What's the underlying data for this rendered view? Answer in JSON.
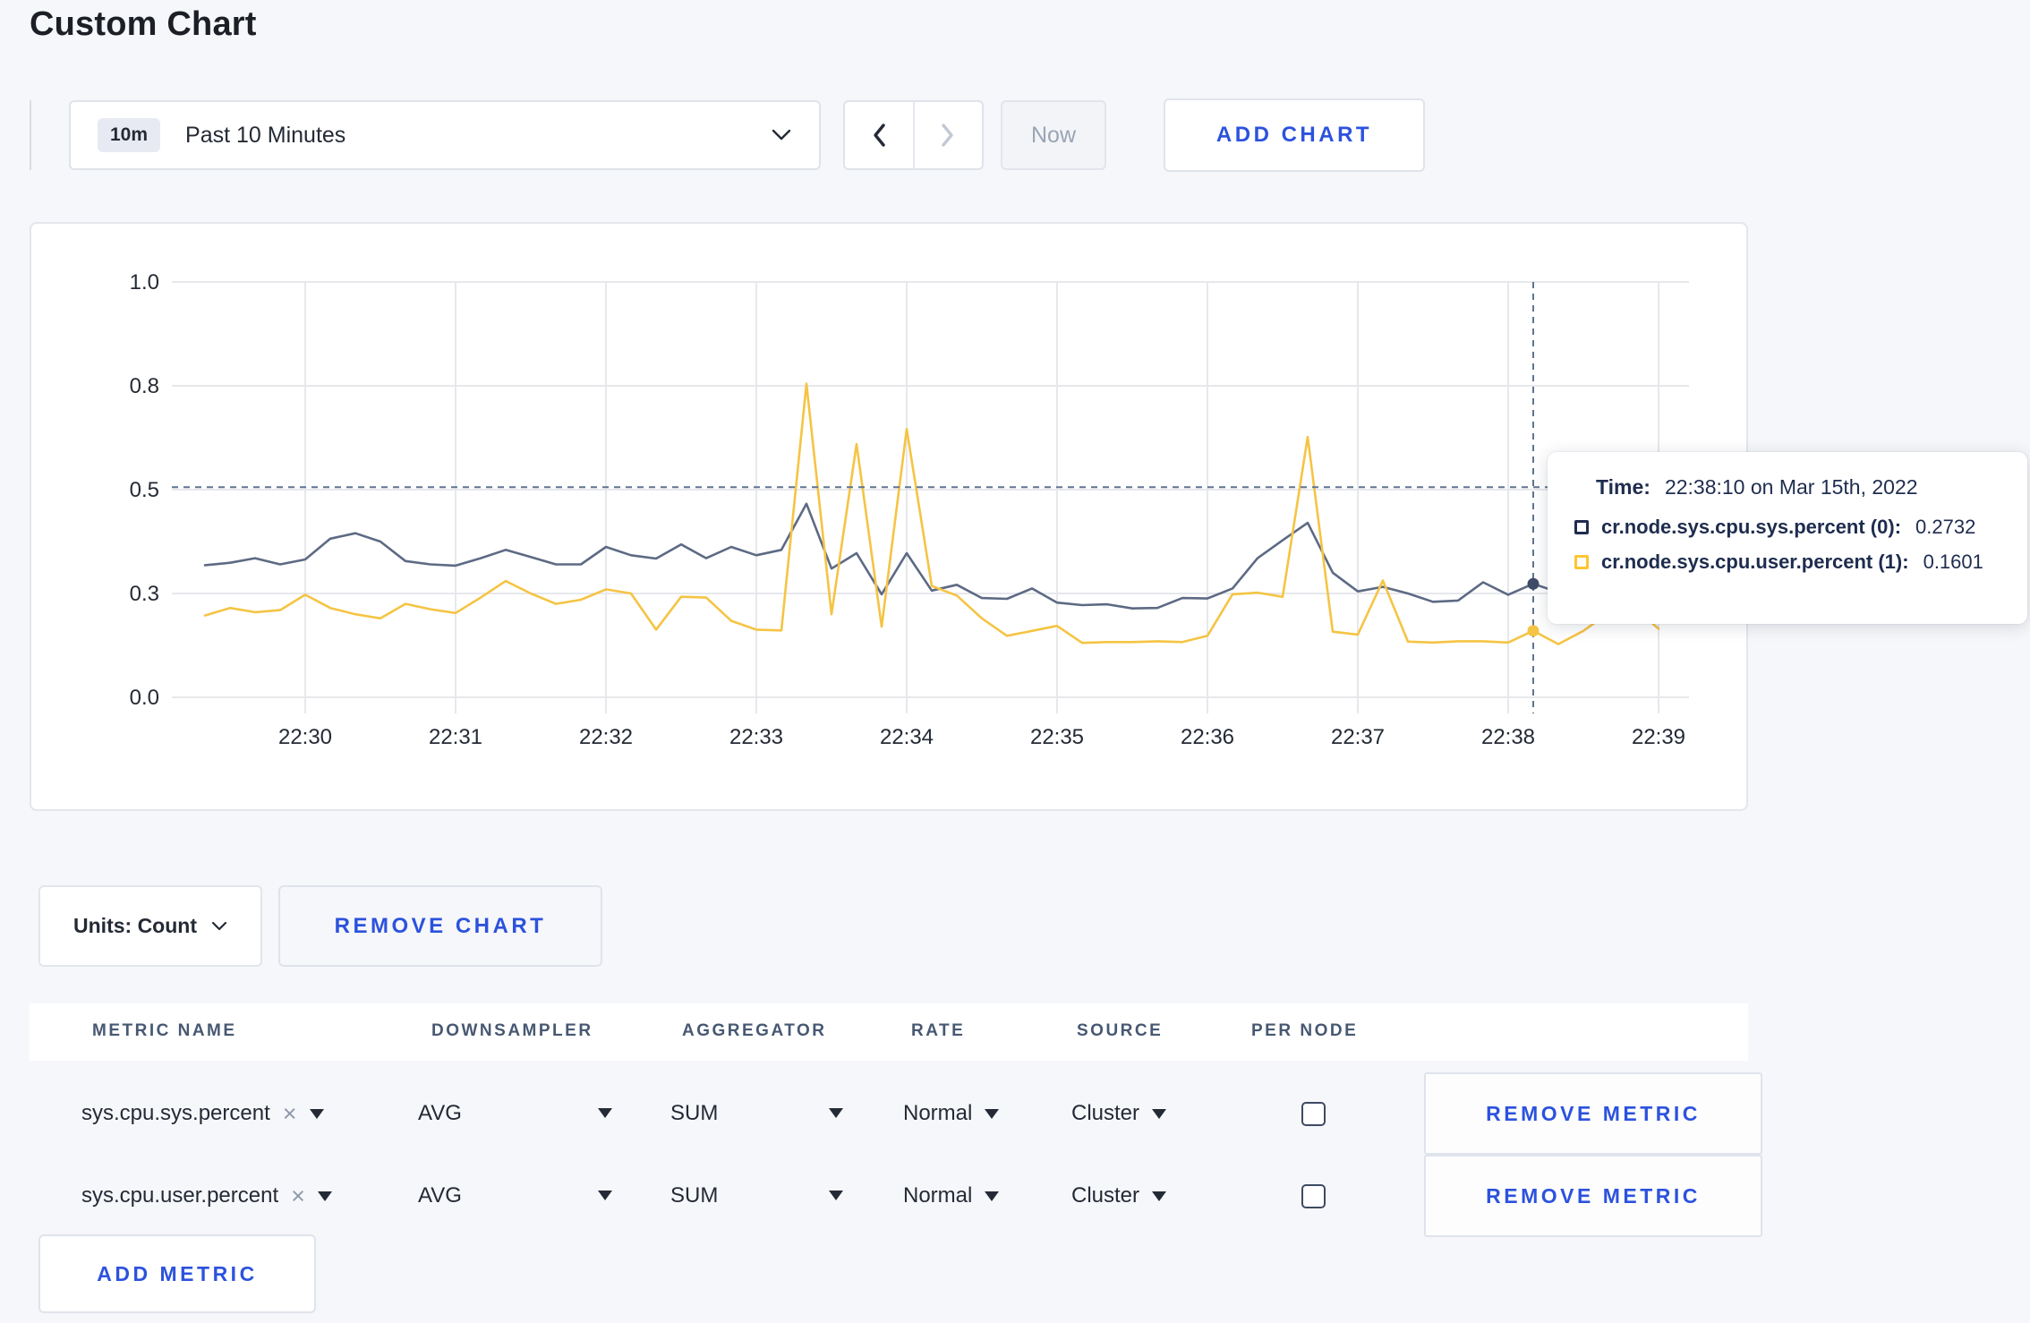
{
  "page": {
    "title": "Custom Chart"
  },
  "toolbar": {
    "time_badge": "10m",
    "time_label": "Past 10 Minutes",
    "now_label": "Now",
    "add_chart_label": "ADD CHART"
  },
  "chart_footer": {
    "units_label": "Units: Count",
    "remove_chart_label": "REMOVE CHART"
  },
  "tooltip": {
    "time_label": "Time:",
    "time_value": "22:38:10 on Mar 15th, 2022",
    "series": [
      {
        "name": "cr.node.sys.cpu.sys.percent (0):",
        "value": "0.2732",
        "swatch_color": "#1f2c4d"
      },
      {
        "name": "cr.node.sys.cpu.user.percent (1):",
        "value": "0.1601",
        "swatch_color": "#fdc531"
      }
    ]
  },
  "chart_data": {
    "type": "line",
    "title": "",
    "xlabel": "",
    "ylabel": "",
    "ylim": [
      0,
      1
    ],
    "grid": true,
    "legend_position": "none",
    "y_ticks": [
      {
        "label": "0.0",
        "value": 0
      },
      {
        "label": "0.3",
        "value": 0.25
      },
      {
        "label": "0.5",
        "value": 0.5
      },
      {
        "label": "0.8",
        "value": 0.75
      },
      {
        "label": "1.0",
        "value": 1
      }
    ],
    "x_tick_labels": [
      "22:30",
      "22:31",
      "22:32",
      "22:33",
      "22:34",
      "22:35",
      "22:36",
      "22:37",
      "22:38",
      "22:39"
    ],
    "times": [
      "22:29:20",
      "22:29:30",
      "22:29:40",
      "22:29:50",
      "22:30:00",
      "22:30:10",
      "22:30:20",
      "22:30:30",
      "22:30:40",
      "22:30:50",
      "22:31:00",
      "22:31:10",
      "22:31:20",
      "22:31:30",
      "22:31:40",
      "22:31:50",
      "22:32:00",
      "22:32:10",
      "22:32:20",
      "22:32:30",
      "22:32:40",
      "22:32:50",
      "22:33:00",
      "22:33:10",
      "22:33:20",
      "22:33:30",
      "22:33:40",
      "22:33:50",
      "22:34:00",
      "22:34:10",
      "22:34:20",
      "22:34:30",
      "22:34:40",
      "22:34:50",
      "22:35:00",
      "22:35:10",
      "22:35:20",
      "22:35:30",
      "22:35:40",
      "22:35:50",
      "22:36:00",
      "22:36:10",
      "22:36:20",
      "22:36:30",
      "22:36:40",
      "22:36:50",
      "22:37:00",
      "22:37:10",
      "22:37:20",
      "22:37:30",
      "22:37:40",
      "22:37:50",
      "22:38:00",
      "22:38:10",
      "22:38:20",
      "22:38:30",
      "22:38:40",
      "22:38:50",
      "22:39:00"
    ],
    "series": [
      {
        "name": "cr.node.sys.cpu.sys.percent",
        "color": "#5d6a84",
        "values": [
          0.318,
          0.324,
          0.335,
          0.32,
          0.332,
          0.382,
          0.395,
          0.375,
          0.328,
          0.32,
          0.317,
          0.335,
          0.355,
          0.338,
          0.32,
          0.32,
          0.362,
          0.342,
          0.334,
          0.368,
          0.335,
          0.362,
          0.342,
          0.355,
          0.466,
          0.31,
          0.347,
          0.248,
          0.347,
          0.257,
          0.271,
          0.239,
          0.237,
          0.262,
          0.228,
          0.222,
          0.224,
          0.214,
          0.215,
          0.239,
          0.238,
          0.262,
          0.335,
          0.378,
          0.42,
          0.3,
          0.255,
          0.266,
          0.25,
          0.23,
          0.233,
          0.277,
          0.247,
          0.2732,
          0.253,
          0.258,
          0.266,
          0.262,
          0.268
        ]
      },
      {
        "name": "cr.node.sys.cpu.user.percent",
        "color": "#f5c444",
        "values": [
          0.197,
          0.215,
          0.205,
          0.21,
          0.247,
          0.215,
          0.2,
          0.19,
          0.225,
          0.212,
          0.203,
          0.24,
          0.28,
          0.25,
          0.225,
          0.235,
          0.26,
          0.25,
          0.163,
          0.242,
          0.24,
          0.184,
          0.163,
          0.161,
          0.755,
          0.2,
          0.61,
          0.17,
          0.646,
          0.268,
          0.245,
          0.19,
          0.148,
          0.16,
          0.172,
          0.131,
          0.133,
          0.133,
          0.135,
          0.133,
          0.148,
          0.248,
          0.252,
          0.242,
          0.627,
          0.158,
          0.151,
          0.281,
          0.134,
          0.132,
          0.135,
          0.135,
          0.132,
          0.1601,
          0.128,
          0.16,
          0.203,
          0.217,
          0.165
        ]
      }
    ],
    "crosshair": {
      "time": "22:38:10",
      "cursor_value": 0.506,
      "point_values": [
        0.2732,
        0.1601
      ]
    },
    "colors": {
      "grid": "#e7e8ec",
      "tick_text": "#242a35",
      "crosshair": "#5e7490"
    }
  },
  "metrics_table": {
    "headers": [
      "METRIC NAME",
      "DOWNSAMPLER",
      "AGGREGATOR",
      "RATE",
      "SOURCE",
      "PER NODE"
    ],
    "rows": [
      {
        "metric": "sys.cpu.sys.percent",
        "downsampler": "AVG",
        "aggregator": "SUM",
        "rate": "Normal",
        "source": "Cluster",
        "per_node_checked": false,
        "remove_label": "REMOVE METRIC"
      },
      {
        "metric": "sys.cpu.user.percent",
        "downsampler": "AVG",
        "aggregator": "SUM",
        "rate": "Normal",
        "source": "Cluster",
        "per_node_checked": false,
        "remove_label": "REMOVE METRIC"
      }
    ],
    "add_metric_label": "ADD METRIC"
  }
}
